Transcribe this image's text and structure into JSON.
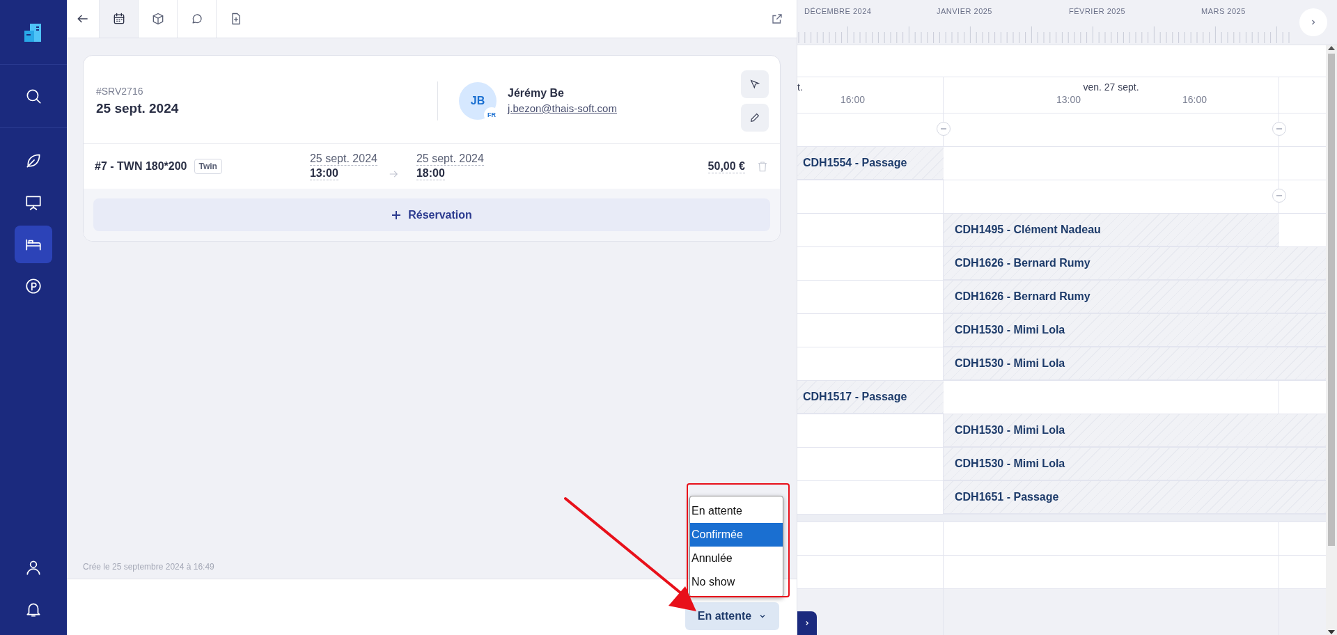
{
  "nav_items": [
    {
      "kind": "search",
      "selected": false
    },
    {
      "kind": "leaf",
      "selected": false
    },
    {
      "kind": "board",
      "selected": false
    },
    {
      "kind": "bed",
      "selected": true
    },
    {
      "kind": "parking",
      "selected": false
    }
  ],
  "nav_bottom": [
    {
      "kind": "user",
      "selected": false
    },
    {
      "kind": "bell",
      "selected": false
    }
  ],
  "tabs": [
    {
      "kind": "calendar",
      "selected": true
    },
    {
      "kind": "cube",
      "selected": false
    },
    {
      "kind": "chat",
      "selected": false
    },
    {
      "kind": "file-plus",
      "selected": false
    }
  ],
  "booking": {
    "reference": "#SRV2716",
    "date": "25 sept. 2024",
    "customer": {
      "initials": "JB",
      "language": "FR",
      "name": "Jérémy Be",
      "email": "j.bezon@thais-soft.com"
    },
    "lines": [
      {
        "room": "#7 - TWN 180*200",
        "tag": "Twin",
        "start_date": "25 sept. 2024",
        "start_time": "13:00",
        "end_date": "25 sept. 2024",
        "end_time": "18:00",
        "price": "50,00 €"
      }
    ],
    "add_button": "Réservation",
    "created": "Crée le 25 septembre 2024 à 16:49",
    "status": "En attente",
    "status_options": [
      {
        "label": "En attente",
        "selected": false
      },
      {
        "label": "Confirmée",
        "selected": true
      },
      {
        "label": "Annulée",
        "selected": false
      },
      {
        "label": "No show",
        "selected": false
      }
    ]
  },
  "timeline": {
    "months": [
      "DÉCEMBRE 2024",
      "JANVIER 2025",
      "FÉVRIER 2025",
      "MARS 2025"
    ],
    "partial_day_label": "t.",
    "left_hours": [
      "16:00"
    ],
    "day_label": "ven. 27 sept.",
    "day_hours": [
      "13:00",
      "16:00"
    ],
    "rows": [
      {
        "kind": "group",
        "start_toggle": true,
        "end_toggle": true
      },
      {
        "kind": "room",
        "bookings": [
          {
            "label": "CDH1554 - Passage",
            "kind": "before"
          }
        ]
      },
      {
        "kind": "group",
        "start_toggle": false,
        "end_toggle": true
      },
      {
        "kind": "room",
        "bookings": [
          {
            "label": "CDH1495 - Clément Nadeau",
            "kind": "day"
          }
        ]
      },
      {
        "kind": "room",
        "bookings": [
          {
            "label": "CDH1626 - Bernard Rumy",
            "kind": "ongoing"
          }
        ]
      },
      {
        "kind": "room",
        "bookings": [
          {
            "label": "CDH1626 - Bernard Rumy",
            "kind": "ongoing"
          }
        ]
      },
      {
        "kind": "room",
        "bookings": [
          {
            "label": "CDH1530 - Mimi Lola",
            "kind": "ongoing"
          }
        ]
      },
      {
        "kind": "room",
        "bookings": [
          {
            "label": "CDH1530 - Mimi Lola",
            "kind": "ongoing"
          }
        ]
      },
      {
        "kind": "room",
        "bookings": [
          {
            "label": "CDH1517 - Passage",
            "kind": "before"
          }
        ]
      },
      {
        "kind": "room",
        "bookings": [
          {
            "label": "CDH1530 - Mimi Lola",
            "kind": "ongoing"
          }
        ]
      },
      {
        "kind": "room",
        "bookings": [
          {
            "label": "CDH1530 - Mimi Lola",
            "kind": "ongoing"
          }
        ]
      },
      {
        "kind": "room",
        "bookings": [
          {
            "label": "CDH1651 - Passage",
            "kind": "ongoing"
          }
        ]
      },
      {
        "kind": "separator"
      },
      {
        "kind": "room",
        "bookings": []
      },
      {
        "kind": "room",
        "bookings": []
      }
    ]
  }
}
